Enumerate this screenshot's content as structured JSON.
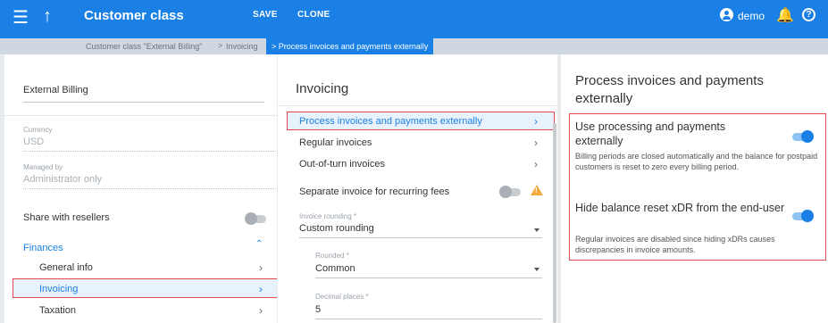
{
  "topbar": {
    "menu_icon": "menu-icon",
    "up_icon": "arrow-up-icon",
    "title": "Customer class",
    "save_label": "SAVE",
    "clone_label": "CLONE",
    "user_name": "demo",
    "accent_color": "#1a80e5"
  },
  "breadcrumb": {
    "item1": "Customer class \"External Billing\"",
    "separator": ">",
    "item2": "Invoicing",
    "active": "> Process invoices and payments externally"
  },
  "left_panel": {
    "name_value": "External Billing",
    "currency_label": "Currency",
    "currency_value": "USD",
    "managed_label": "Managed by",
    "managed_value": "Administrator only",
    "share_label": "Share with resellers",
    "share_enabled": false,
    "section_label": "Finances",
    "nav_items": [
      "General info",
      "Invoicing",
      "Taxation"
    ],
    "selected_item": "Invoicing"
  },
  "middle_panel": {
    "title": "Invoicing",
    "items": [
      "Process invoices and payments externally",
      "Regular invoices",
      "Out-of-turn invoices"
    ],
    "separate_label": "Separate invoice for recurring fees",
    "separate_enabled": false,
    "rounding_label": "Invoice rounding *",
    "rounding_value": "Custom rounding",
    "rounded_label": "Rounded *",
    "rounded_value": "Common",
    "decimal_label": "Decimal places *",
    "decimal_value": "5"
  },
  "right_panel": {
    "heading": "Process invoices and payments externally",
    "options": [
      {
        "title": "Use processing and payments externally",
        "description": "Billing periods are closed automatically and the balance for postpaid customers is reset to zero every billing period.",
        "enabled": true
      },
      {
        "title": "Hide balance reset xDR from the end-user",
        "description": "Regular invoices are disabled since hiding xDRs causes discrepancies in invoice amounts.",
        "enabled": true
      }
    ]
  }
}
